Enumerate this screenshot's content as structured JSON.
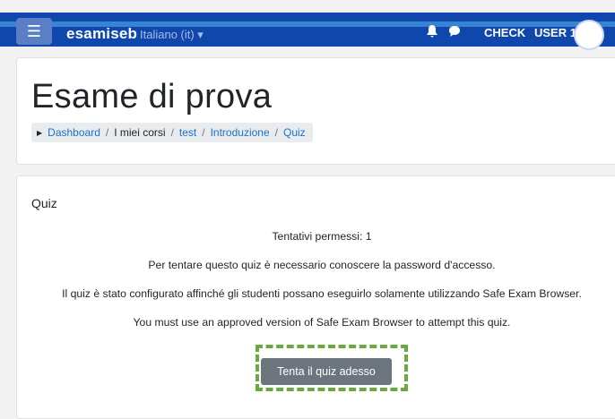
{
  "navbar": {
    "menu_icon": "hamburger-icon",
    "brand": "esamiseb",
    "language": "Italiano (it) ▾",
    "notifications_icon": "bell-icon",
    "messages_icon": "chat-icon",
    "check_label": "CHECK",
    "user_label": "USER 1",
    "color": "#0f47ad"
  },
  "header": {
    "title": "Esame di prova",
    "breadcrumb": [
      "Dashboard",
      "I miei corsi",
      "test",
      "Introduzione",
      "Quiz"
    ]
  },
  "quiz": {
    "heading": "Quiz",
    "attempts": "Tentativi permessi: 1",
    "password_note": "Per tentare questo quiz è necessario conoscere la password d'accesso.",
    "seb_note": "Il quiz è stato configurato affinché gli studenti possano eseguirlo solamente utilizzando Safe Exam Browser.",
    "seb_version_note": "You must use an approved version of Safe Exam Browser to attempt this quiz.",
    "attempt_button": "Tenta il quiz adesso"
  }
}
